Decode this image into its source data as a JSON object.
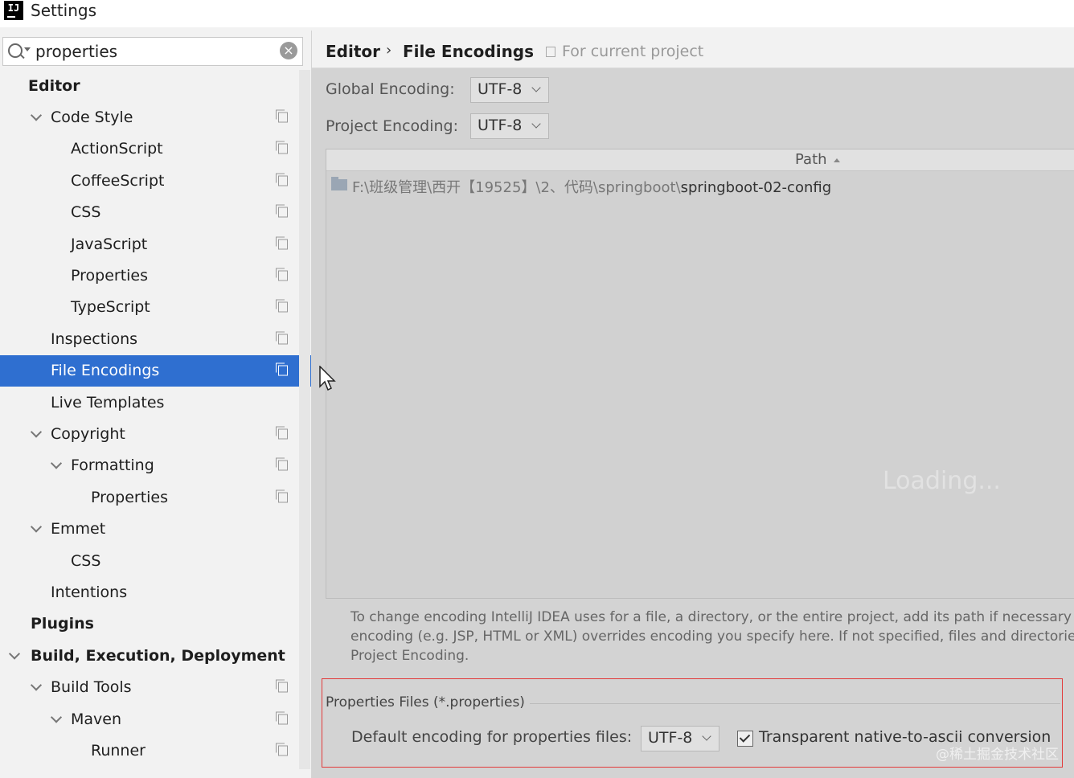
{
  "window": {
    "title": "Settings",
    "app_icon_text": "IJ"
  },
  "search": {
    "value": "properties"
  },
  "tree": [
    {
      "label": "Editor",
      "level": 0,
      "bold": true,
      "chevron": false,
      "copy": false
    },
    {
      "label": "Code Style",
      "level": 1,
      "chevron": true,
      "copy": true
    },
    {
      "label": "ActionScript",
      "level": 2,
      "copy": true
    },
    {
      "label": "CoffeeScript",
      "level": 2,
      "copy": true
    },
    {
      "label": "CSS",
      "level": 2,
      "copy": true
    },
    {
      "label": "JavaScript",
      "level": 2,
      "copy": true
    },
    {
      "label": "Properties",
      "level": 2,
      "copy": true
    },
    {
      "label": "TypeScript",
      "level": 2,
      "copy": true
    },
    {
      "label": "Inspections",
      "level": 1,
      "copy": true
    },
    {
      "label": "File Encodings",
      "level": 1,
      "copy": true,
      "selected": true
    },
    {
      "label": "Live Templates",
      "level": 1,
      "copy": false
    },
    {
      "label": "Copyright",
      "level": 1,
      "chevron": true,
      "copy": true
    },
    {
      "label": "Formatting",
      "level": 2,
      "chevron": true,
      "copy": true
    },
    {
      "label": "Properties",
      "level": 3,
      "copy": true
    },
    {
      "label": "Emmet",
      "level": 1,
      "chevron": true,
      "copy": false
    },
    {
      "label": "CSS",
      "level": 2,
      "copy": false
    },
    {
      "label": "Intentions",
      "level": 1,
      "copy": false
    },
    {
      "label": "Plugins",
      "level": 0,
      "bold": true,
      "copy": false
    },
    {
      "label": "Build, Execution, Deployment",
      "level": 0,
      "bold": true,
      "chevron": true,
      "copy": false
    },
    {
      "label": "Build Tools",
      "level": 1,
      "chevron": true,
      "copy": true
    },
    {
      "label": "Maven",
      "level": 2,
      "chevron": true,
      "copy": true
    },
    {
      "label": "Runner",
      "level": 3,
      "copy": true
    }
  ],
  "breadcrumb": {
    "parent": "Editor",
    "current": "File Encodings",
    "scope": "For current project"
  },
  "global_encoding": {
    "label": "Global Encoding:",
    "value": "UTF-8"
  },
  "project_encoding": {
    "label": "Project Encoding:",
    "value": "UTF-8"
  },
  "table": {
    "column": "Path",
    "rows": [
      {
        "dim": "F:\\班级管理\\西开【19525】\\2、代码\\springboot\\",
        "bright": "springboot-02-config"
      }
    ],
    "loading": "Loading..."
  },
  "hint": {
    "line1": "To change encoding IntelliJ IDEA uses for a file, a directory, or the entire project, add its path if necessary and",
    "line2": "encoding (e.g. JSP, HTML or XML) overrides encoding you specify here. If not specified, files and directories i",
    "line3": "Project Encoding."
  },
  "properties": {
    "title": "Properties Files (*.properties)",
    "default_label": "Default encoding for properties files:",
    "default_value": "UTF-8",
    "transparent_label": "Transparent native-to-ascii conversion",
    "transparent_checked": true
  },
  "watermark": "@稀土掘金技术社区"
}
